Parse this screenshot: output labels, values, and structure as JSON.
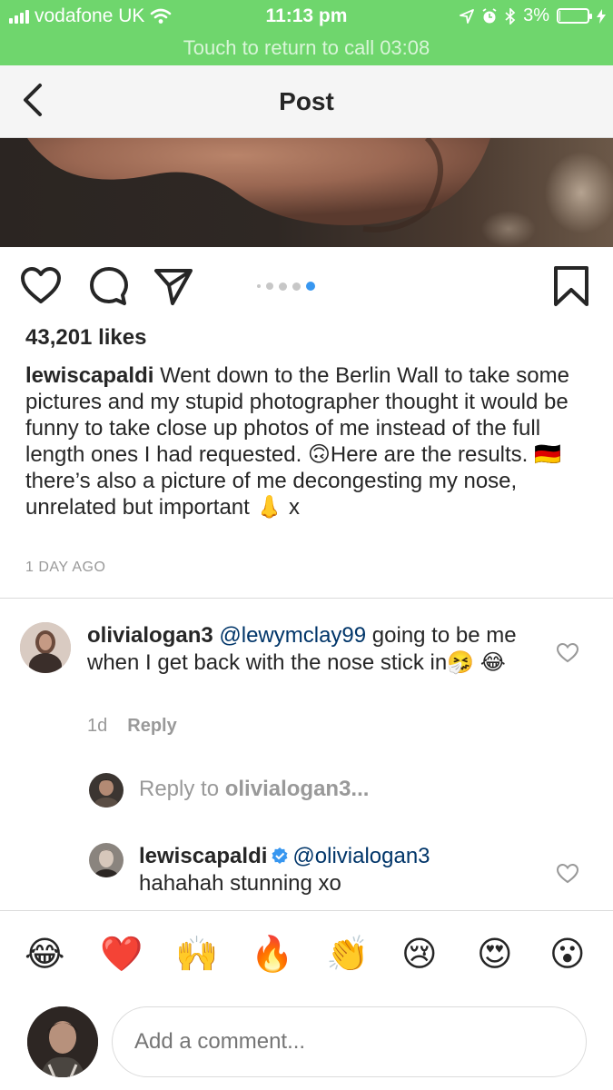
{
  "status_bar": {
    "carrier": "vodafone UK",
    "time": "11:13 pm",
    "battery": "3%",
    "battery_level": 0.03
  },
  "call_banner": {
    "text": "Touch to return to call 03:08"
  },
  "nav": {
    "title": "Post",
    "back_icon": "chevron-left-icon"
  },
  "post": {
    "carousel": {
      "count": 5,
      "active_index": 4
    },
    "likes": "43,201 likes",
    "caption": {
      "username": "lewiscapaldi",
      "text": " Went down to the Berlin Wall to take some pictures and my stupid photographer thought it would be funny to take close up photos of me instead of the full length ones I had requested. 🙃Here are the results. 🇩🇪 there’s also a picture of me decongesting my nose, unrelated but important 👃 x"
    },
    "time_ago": "1 DAY AGO"
  },
  "comments": [
    {
      "username": "olivialogan3",
      "mention": "@lewymclay99",
      "text": " going to be me when I get back with the nose stick in🤧 😂",
      "age": "1d",
      "reply_label": "Reply"
    }
  ],
  "reply_prompt": {
    "prefix": "Reply to ",
    "username": "olivialogan3..."
  },
  "replies": [
    {
      "username": "lewiscapaldi",
      "mention": "@olivialogan3",
      "text": "hahahah stunning xo"
    }
  ],
  "emoji_bar": [
    "😂",
    "❤️",
    "🙌",
    "🔥",
    "👏",
    "😢",
    "😍",
    "😮"
  ],
  "composer": {
    "placeholder": "Add a comment..."
  },
  "colors": {
    "status_green": "#6fd66d",
    "link_blue": "#003569",
    "active_dot": "#3897f0",
    "verified_blue": "#3897f0"
  }
}
